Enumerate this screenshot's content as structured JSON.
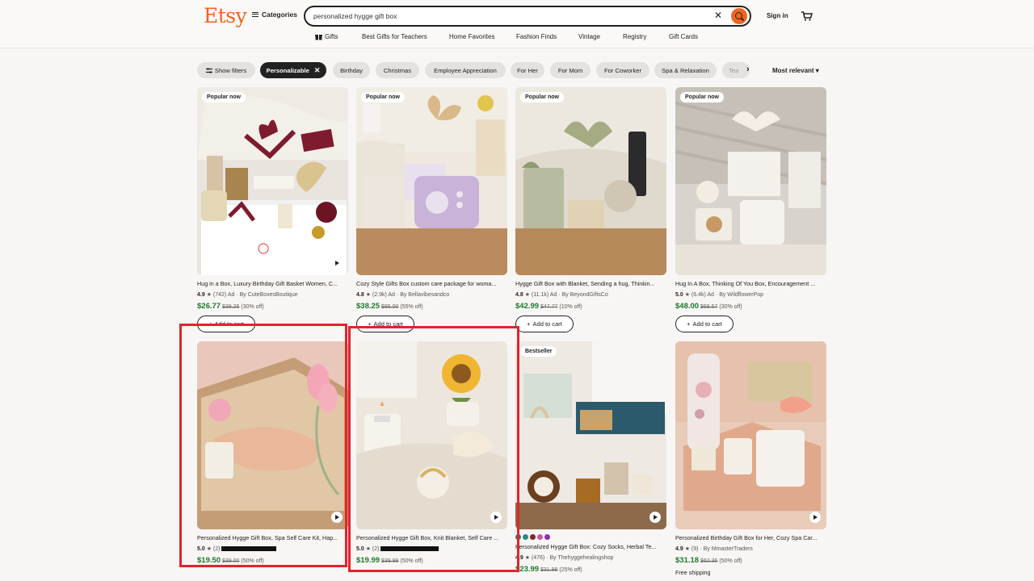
{
  "header": {
    "logo": "Etsy",
    "categories_label": "Categories",
    "search_value": "personalized hygge gift box",
    "signin_label": "Sign in"
  },
  "subnav": [
    {
      "label": "Gifts",
      "icon": "gift-icon"
    },
    {
      "label": "Best Gifts for Teachers"
    },
    {
      "label": "Home Favorites"
    },
    {
      "label": "Fashion Finds"
    },
    {
      "label": "Vintage"
    },
    {
      "label": "Registry"
    },
    {
      "label": "Gift Cards"
    }
  ],
  "filters": {
    "show_filters": "Show filters",
    "chips": [
      "Personalizable",
      "Birthday",
      "Christmas",
      "Employee Appreciation",
      "For Her",
      "For Mom",
      "For Coworker",
      "Spa & Relaxation",
      "Tea"
    ],
    "sort_label": "Most relevant"
  },
  "add_to_cart_label": "Add to cart",
  "listings": [
    {
      "badge": "Popular now",
      "title": "Hug in a Box, Luxury Birthday Gift Basket Women, C...",
      "rating": "4.9",
      "reviews": "(742)",
      "ad": "Ad",
      "shop": "By CuteBoxesBoutique",
      "price": "$26.77",
      "orig": "$38.25",
      "off": "(30% off)",
      "play_icon": "play-icon"
    },
    {
      "badge": "Popular now",
      "title": "Cozy Style Gifts Box custom care package for woma...",
      "rating": "4.8",
      "reviews": "(2.9k)",
      "ad": "Ad",
      "shop": "By Bellavibesandco",
      "price": "$38.25",
      "orig": "$85.00",
      "off": "(55% off)"
    },
    {
      "badge": "Popular now",
      "title": "Hygge Gift Box with Blanket, Sending a hug, Thinkin...",
      "rating": "4.8",
      "reviews": "(11.1k)",
      "ad": "Ad",
      "shop": "By BeyondGiftsCo",
      "price": "$42.99",
      "orig": "$47.77",
      "off": "(10% off)"
    },
    {
      "badge": "Popular now",
      "title": "Hug In A Box, Thinking Of You Box, Encouragement ...",
      "rating": "5.0",
      "reviews": "(6.4k)",
      "ad": "Ad",
      "shop": "By WildflowerPop",
      "price": "$48.00",
      "orig": "$68.57",
      "off": "(30% off)"
    },
    {
      "badge": "",
      "title": "Personalized Hygge Gift Box, Spa Self Care Kit, Hap...",
      "rating": "5.0",
      "reviews": "(2)",
      "ad": "",
      "shop": "",
      "price": "$19.50",
      "orig": "$39.00",
      "off": "(50% off)"
    },
    {
      "badge": "",
      "title": "Personalized Hygge Gift Box, Knit Blanket, Self Care ...",
      "rating": "5.0",
      "reviews": "(2)",
      "ad": "",
      "shop": "",
      "price": "$19.99",
      "orig": "$39.99",
      "off": "(50% off)"
    },
    {
      "badge": "Bestseller",
      "title": "Personalized Hygge Gift Box: Cozy Socks, Herbal Te...",
      "rating": "4.9",
      "reviews": "(476)",
      "ad": "",
      "shop": "By Thehyggehealingshop",
      "price": "$23.99",
      "orig": "$31.99",
      "off": "(25% off)"
    },
    {
      "badge": "",
      "title": "Personalized Birthday Gift Box for Her, Cozy Spa Car...",
      "rating": "4.9",
      "reviews": "(9)",
      "ad": "",
      "shop": "By MmasterTraders",
      "price": "$31.18",
      "orig": "$62.36",
      "off": "(50% off)",
      "shipping": "Free shipping"
    }
  ],
  "colors": {
    "brand": "#f1641e",
    "price_green": "#1b7a2c",
    "highlight_red": "#e0252b"
  }
}
